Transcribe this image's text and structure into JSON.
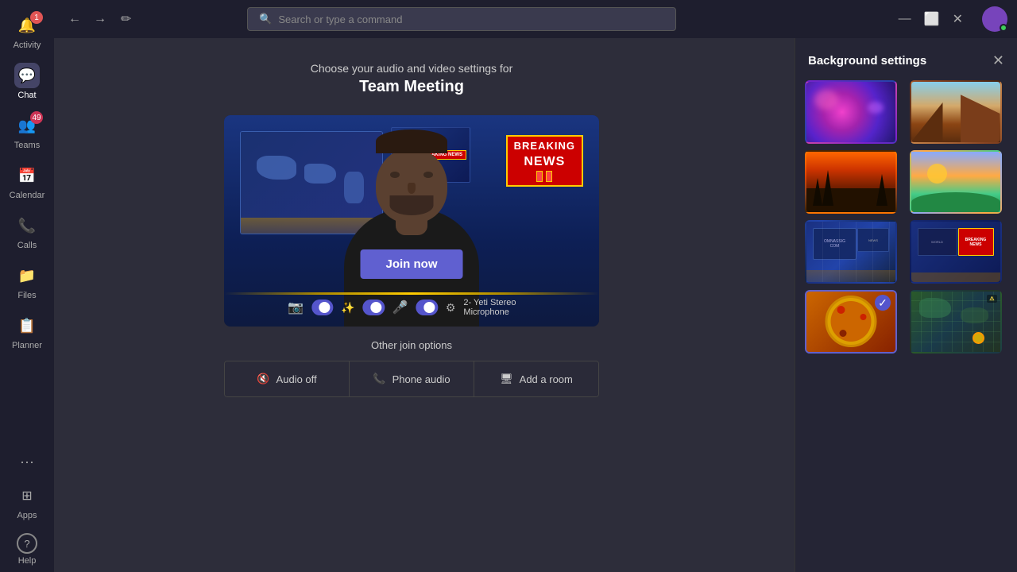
{
  "topbar": {
    "search_placeholder": "Search or type a command",
    "compose_icon": "✏",
    "back_icon": "←",
    "forward_icon": "→",
    "minimize_icon": "—",
    "maximize_icon": "⬜",
    "close_icon": "✕"
  },
  "sidebar": {
    "items": [
      {
        "id": "activity",
        "label": "Activity",
        "icon": "🔔",
        "badge": "1",
        "active": false
      },
      {
        "id": "chat",
        "label": "Chat",
        "icon": "💬",
        "badge": null,
        "active": true
      },
      {
        "id": "teams",
        "label": "Teams",
        "icon": "👥",
        "badge": "49",
        "active": false
      },
      {
        "id": "calendar",
        "label": "Calendar",
        "icon": "📅",
        "badge": null,
        "active": false
      },
      {
        "id": "calls",
        "label": "Calls",
        "icon": "📞",
        "badge": null,
        "active": false
      },
      {
        "id": "files",
        "label": "Files",
        "icon": "📁",
        "badge": null,
        "active": false
      },
      {
        "id": "planner",
        "label": "Planner",
        "icon": "📋",
        "badge": null,
        "active": false
      }
    ],
    "more_label": "···",
    "apps_label": "Apps",
    "apps_icon": "⊞",
    "help_label": "Help",
    "help_icon": "?"
  },
  "main": {
    "subtitle": "Choose your audio and video settings for",
    "meeting_name": "Team Meeting",
    "join_now_label": "Join now",
    "other_join_title": "Other join options",
    "join_options": [
      {
        "id": "audio-off",
        "label": "Audio off",
        "icon": "🔇"
      },
      {
        "id": "phone-audio",
        "label": "Phone audio",
        "icon": "📞"
      },
      {
        "id": "add-room",
        "label": "Add a room",
        "icon": "🖥"
      }
    ],
    "controls": {
      "mic_device": "2- Yeti Stereo Microphone"
    }
  },
  "bg_panel": {
    "title": "Background settings",
    "close_icon": "✕",
    "thumbnails": [
      {
        "id": "galaxy",
        "class": "bg-galaxy",
        "selected": false
      },
      {
        "id": "canyon",
        "class": "bg-canyon",
        "selected": false
      },
      {
        "id": "sunset",
        "class": "bg-sunset",
        "selected": false
      },
      {
        "id": "fantasy",
        "class": "bg-fantasy",
        "selected": false
      },
      {
        "id": "studio1",
        "class": "bg-studio1",
        "selected": false
      },
      {
        "id": "news",
        "class": "bg-news",
        "selected": false,
        "label": "BREAKING NEWS"
      },
      {
        "id": "pizza",
        "class": "bg-pizza",
        "selected": true
      },
      {
        "id": "map",
        "class": "bg-map",
        "selected": false
      }
    ]
  }
}
